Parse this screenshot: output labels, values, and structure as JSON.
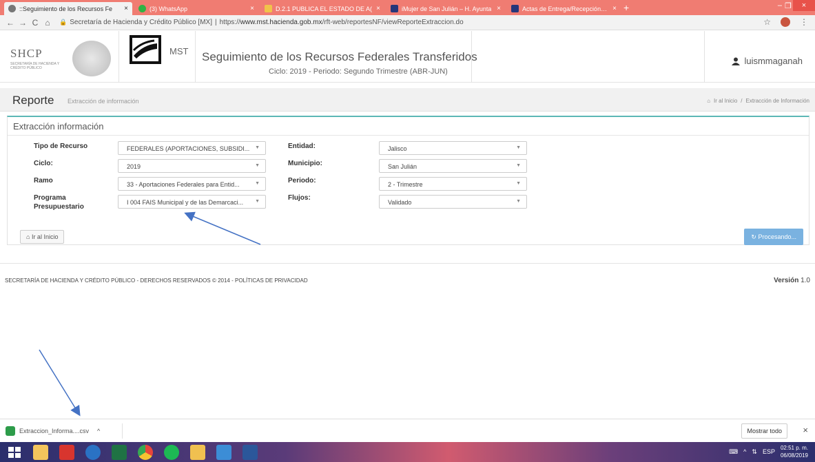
{
  "browser": {
    "tabs": [
      {
        "label": "::Seguimiento de los Recursos Fe",
        "icon_color": "#555555",
        "active": true
      },
      {
        "label": "(3) WhatsApp",
        "icon_color": "#2fb344",
        "active": false
      },
      {
        "label": "D.2.1 PUBLICA EL ESTADO DE A(",
        "icon_color": "#f1c34a",
        "active": false
      },
      {
        "label": "iMujer de San Julián – H. Ayunta",
        "icon_color": "#26367a",
        "active": false
      },
      {
        "label": "Actas de Entrega/Recepción – H",
        "icon_color": "#26367a",
        "active": false
      }
    ],
    "tab_close": "×",
    "new_tab": "+",
    "window_controls": {
      "minimize": "–",
      "restore": "❐",
      "close": "×"
    },
    "nav": {
      "back": "←",
      "forward": "→",
      "reload": "C",
      "home": "⌂"
    },
    "address": {
      "site_label": "Secretaría de Hacienda y Crédito Público [MX]",
      "separator": "|",
      "url_prefix": "https://",
      "url_host": "www.mst.hacienda.gob.mx",
      "url_path": "/rft-web/reportesNF/viewReporteExtraccion.do"
    },
    "right_icons": {
      "star": "☆",
      "menu": "⋮"
    }
  },
  "header": {
    "shcp_title": "SHCP",
    "shcp_subtitle": "SECRETARÍA DE HACIENDA Y CRÉDITO PÚBLICO",
    "mst_text": "MST",
    "title": "Seguimiento de los Recursos Federales Transferidos",
    "subtitle": "Ciclo: 2019 - Periodo: Segundo Trimestre (ABR-JUN)",
    "user_icon": "user-icon",
    "username": "luismmaganah"
  },
  "page": {
    "title": "Reporte",
    "subtitle": "Extracción de información",
    "breadcrumb": {
      "home": "Ir al Inicio",
      "separator": "/",
      "current": "Extracción de Información"
    }
  },
  "panel": {
    "title": "Extracción información",
    "left_fields": [
      {
        "label_lines": [
          "Tipo de Recurso"
        ],
        "value": "FEDERALES (APORTACIONES, SUBSIDI..."
      },
      {
        "label_lines": [
          "Ciclo:"
        ],
        "value": "2019"
      },
      {
        "label_lines": [
          "Ramo"
        ],
        "value": "33 - Aportaciones Federales para Entid..."
      },
      {
        "label_lines": [
          "Programa",
          "Presupuestario"
        ],
        "value": "I 004 FAIS Municipal y de las Demarcaci..."
      }
    ],
    "right_fields": [
      {
        "label": "Entidad:",
        "value": "Jalisco"
      },
      {
        "label": "Municipio:",
        "value": "San Julián"
      },
      {
        "label": "Periodo:",
        "value": "2 - Trimestre"
      },
      {
        "label": "Flujos:",
        "value": "Validado"
      }
    ],
    "caret": "▼",
    "home_button": "Ir al Inicio",
    "process_button": "Procesando..."
  },
  "footer": {
    "left": "SECRETARÍA DE HACIENDA Y CRÉDITO PÚBLICO - DERECHOS RESERVADOS © 2014 - POLÍTICAS DE PRIVACIDAD",
    "version_label": "Versión",
    "version_value": "1.0"
  },
  "downloads": {
    "file": "Extraccion_Informa....csv",
    "chevron": "^",
    "show_all": "Mostrar todo",
    "close": "×"
  },
  "taskbar": {
    "apps": [
      {
        "name": "start",
        "color": "#ffffff"
      },
      {
        "name": "file-explorer",
        "color": "#f4c55c"
      },
      {
        "name": "acrobat",
        "color": "#d8352e"
      },
      {
        "name": "outlook",
        "color": "#2a72c4"
      },
      {
        "name": "excel",
        "color": "#1f7244"
      },
      {
        "name": "chrome",
        "color": "#e8453c"
      },
      {
        "name": "spotify",
        "color": "#1db954"
      },
      {
        "name": "folder",
        "color": "#f0c050"
      },
      {
        "name": "app",
        "color": "#3c8dd6"
      },
      {
        "name": "word",
        "color": "#2b579a"
      }
    ],
    "lang": "ESP",
    "time": "02:51 p. m.",
    "date": "06/08/2019"
  },
  "colors": {
    "accent_teal": "#5cb7b5",
    "process_blue": "#7ab2e0",
    "tabstrip": "#f07c72",
    "arrow": "#4472c4"
  }
}
